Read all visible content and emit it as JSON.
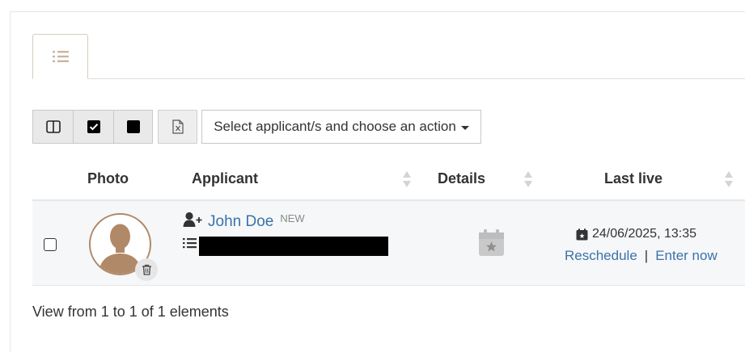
{
  "tabs": [
    {
      "icon": "list-icon",
      "active": true
    }
  ],
  "toolbar": {
    "buttons": [
      {
        "icon": "columns-icon"
      },
      {
        "icon": "checkbox-checked-icon"
      },
      {
        "icon": "square-filled-icon"
      },
      {
        "icon": "excel-export-icon"
      }
    ],
    "action_select_label": "Select applicant/s and choose an action"
  },
  "table": {
    "columns": [
      "Photo",
      "Applicant",
      "Details",
      "Last live"
    ],
    "rows": [
      {
        "applicant_name": "John Doe",
        "badge": "NEW",
        "last_live": "24/06/2025, 13:35",
        "reschedule_label": "Reschedule",
        "separator": "|",
        "enter_label": "Enter now"
      }
    ]
  },
  "footer": {
    "info": "View from 1 to 1 of 1 elements"
  },
  "colors": {
    "accent": "#b08968",
    "link": "#3b73a8",
    "row_bg": "#f5f7f9"
  }
}
